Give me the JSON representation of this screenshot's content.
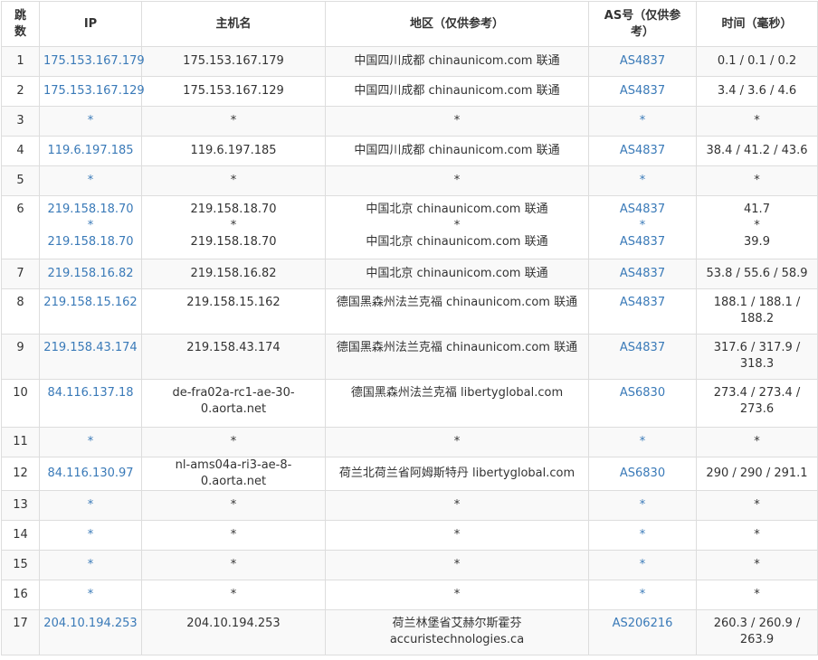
{
  "headers": {
    "hop": "跳数",
    "ip": "IP",
    "host": "主机名",
    "region": "地区（仅供参考）",
    "as": "AS号（仅供参考）",
    "time": "时间（毫秒）"
  },
  "rows": [
    {
      "hop": "1",
      "ip": [
        "175.153.167.179"
      ],
      "host": [
        "175.153.167.179"
      ],
      "region": [
        "中国四川成都 chinaunicom.com 联通"
      ],
      "as": [
        "AS4837"
      ],
      "time": [
        "0.1 / 0.1 / 0.2"
      ]
    },
    {
      "hop": "2",
      "ip": [
        "175.153.167.129"
      ],
      "host": [
        "175.153.167.129"
      ],
      "region": [
        "中国四川成都 chinaunicom.com 联通"
      ],
      "as": [
        "AS4837"
      ],
      "time": [
        "3.4 / 3.6 / 4.6"
      ]
    },
    {
      "hop": "3",
      "ip": [
        "*"
      ],
      "host": [
        "*"
      ],
      "region": [
        "*"
      ],
      "as": [
        "*"
      ],
      "time": [
        "*"
      ]
    },
    {
      "hop": "4",
      "ip": [
        "119.6.197.185"
      ],
      "host": [
        "119.6.197.185"
      ],
      "region": [
        "中国四川成都 chinaunicom.com 联通"
      ],
      "as": [
        "AS4837"
      ],
      "time": [
        "38.4 / 41.2 / 43.6"
      ]
    },
    {
      "hop": "5",
      "ip": [
        "*"
      ],
      "host": [
        "*"
      ],
      "region": [
        "*"
      ],
      "as": [
        "*"
      ],
      "time": [
        "*"
      ]
    },
    {
      "hop": "6",
      "ip": [
        "219.158.18.70",
        "*",
        "219.158.18.70"
      ],
      "host": [
        "219.158.18.70",
        "*",
        "219.158.18.70"
      ],
      "region": [
        "中国北京 chinaunicom.com 联通",
        "*",
        "中国北京 chinaunicom.com 联通"
      ],
      "as": [
        "AS4837",
        "*",
        "AS4837"
      ],
      "time": [
        "41.7",
        "*",
        "39.9"
      ]
    },
    {
      "hop": "7",
      "ip": [
        "219.158.16.82"
      ],
      "host": [
        "219.158.16.82"
      ],
      "region": [
        "中国北京 chinaunicom.com 联通"
      ],
      "as": [
        "AS4837"
      ],
      "time": [
        "53.8 / 55.6 / 58.9"
      ]
    },
    {
      "hop": "8",
      "ip": [
        "219.158.15.162"
      ],
      "host": [
        "219.158.15.162"
      ],
      "region": [
        "德国黑森州法兰克福 chinaunicom.com 联通"
      ],
      "as": [
        "AS4837"
      ],
      "time": [
        "188.1 / 188.1 /",
        "188.2"
      ]
    },
    {
      "hop": "9",
      "ip": [
        "219.158.43.174"
      ],
      "host": [
        "219.158.43.174"
      ],
      "region": [
        "德国黑森州法兰克福 chinaunicom.com 联通"
      ],
      "as": [
        "AS4837"
      ],
      "time": [
        "317.6 / 317.9 /",
        "318.3"
      ]
    },
    {
      "hop": "10",
      "ip": [
        "84.116.137.18"
      ],
      "host": [
        "de-fra02a-rc1-ae-30-",
        "0.aorta.net"
      ],
      "region": [
        "德国黑森州法兰克福 libertyglobal.com"
      ],
      "as": [
        "AS6830"
      ],
      "time": [
        "273.4 / 273.4 /",
        "273.6"
      ]
    },
    {
      "hop": "11",
      "ip": [
        "*"
      ],
      "host": [
        "*"
      ],
      "region": [
        "*"
      ],
      "as": [
        "*"
      ],
      "time": [
        "*"
      ]
    },
    {
      "hop": "12",
      "ip": [
        "84.116.130.97"
      ],
      "host": [
        "nl-ams04a-ri3-ae-8-0.aorta.net"
      ],
      "region": [
        "荷兰北荷兰省阿姆斯特丹 libertyglobal.com"
      ],
      "as": [
        "AS6830"
      ],
      "time": [
        "290 / 290 / 291.1"
      ]
    },
    {
      "hop": "13",
      "ip": [
        "*"
      ],
      "host": [
        "*"
      ],
      "region": [
        "*"
      ],
      "as": [
        "*"
      ],
      "time": [
        "*"
      ]
    },
    {
      "hop": "14",
      "ip": [
        "*"
      ],
      "host": [
        "*"
      ],
      "region": [
        "*"
      ],
      "as": [
        "*"
      ],
      "time": [
        "*"
      ]
    },
    {
      "hop": "15",
      "ip": [
        "*"
      ],
      "host": [
        "*"
      ],
      "region": [
        "*"
      ],
      "as": [
        "*"
      ],
      "time": [
        "*"
      ]
    },
    {
      "hop": "16",
      "ip": [
        "*"
      ],
      "host": [
        "*"
      ],
      "region": [
        "*"
      ],
      "as": [
        "*"
      ],
      "time": [
        "*"
      ]
    },
    {
      "hop": "17",
      "ip": [
        "204.10.194.253"
      ],
      "host": [
        "204.10.194.253"
      ],
      "region": [
        "荷兰林堡省艾赫尔斯霍芬",
        "accuristechnologies.ca"
      ],
      "as": [
        "AS206216"
      ],
      "time": [
        "260.3 / 260.9 /",
        "263.9"
      ]
    }
  ]
}
